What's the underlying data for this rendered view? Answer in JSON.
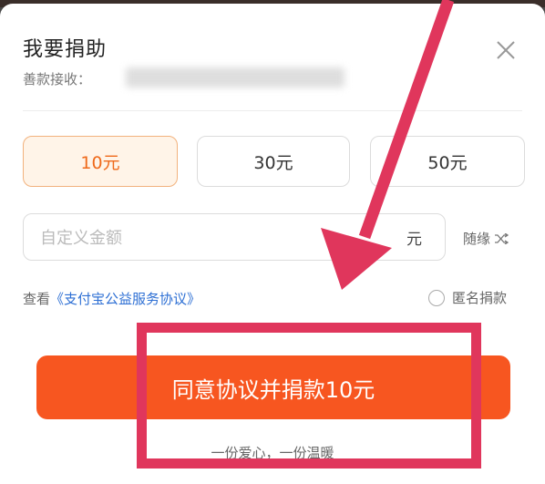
{
  "sheet": {
    "title": "我要捐助",
    "receiver_label": "善款接收：",
    "close_icon": "close-icon"
  },
  "amounts": [
    {
      "label": "10元",
      "selected": true
    },
    {
      "label": "30元",
      "selected": false
    },
    {
      "label": "50元",
      "selected": false
    }
  ],
  "custom_amount": {
    "placeholder": "自定义金额",
    "unit": "元",
    "random_label": "随缘",
    "random_icon": "shuffle-icon"
  },
  "agreement": {
    "prefix": "查看",
    "link": "《支付宝公益服务协议》"
  },
  "anonymous": {
    "label": "匿名捐款",
    "checked": false
  },
  "donate_button": {
    "label": "同意协议并捐款10元"
  },
  "slogan": "一份爱心，一份温暖",
  "annotation": {
    "color": "#e0365c"
  },
  "colors": {
    "accent": "#f75620",
    "selected_text": "#ef6a1b",
    "link": "#2d6fd4"
  }
}
